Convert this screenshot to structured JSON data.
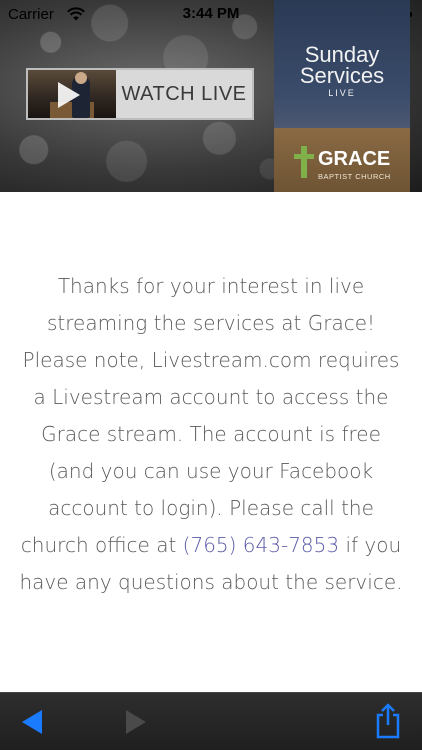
{
  "status_bar": {
    "carrier": "Carrier",
    "time": "3:44 PM",
    "wifi_icon": "wifi-icon",
    "battery_icon": "battery-icon"
  },
  "banner": {
    "watch_live": {
      "label": "WATCH LIVE",
      "icon": "play-icon"
    },
    "services_card": {
      "title_line1": "Sunday",
      "title_line2": "Services",
      "subtitle": "LIVE",
      "church_name": "GRACE",
      "church_subtitle": "BAPTIST CHURCH",
      "logo_icon": "cross-icon"
    }
  },
  "message": {
    "text_before_phone": "Thanks for your interest in live streaming the services at Grace! Please note, Livestream.com requires a Livestream account to access the Grace stream. The account is free (and you can use your Facebook account to login). Please call the church office at ",
    "phone": "(765) 643-7853",
    "text_after_phone": " if you have any questions about the service."
  },
  "toolbar": {
    "back_icon": "back-arrow-icon",
    "forward_icon": "forward-arrow-icon",
    "share_icon": "share-icon"
  },
  "colors": {
    "link": "#5a5aa8",
    "accent_blue": "#1b7bff",
    "text": "#5a5a5a",
    "toolbar_bg": "#2a2a2a"
  }
}
